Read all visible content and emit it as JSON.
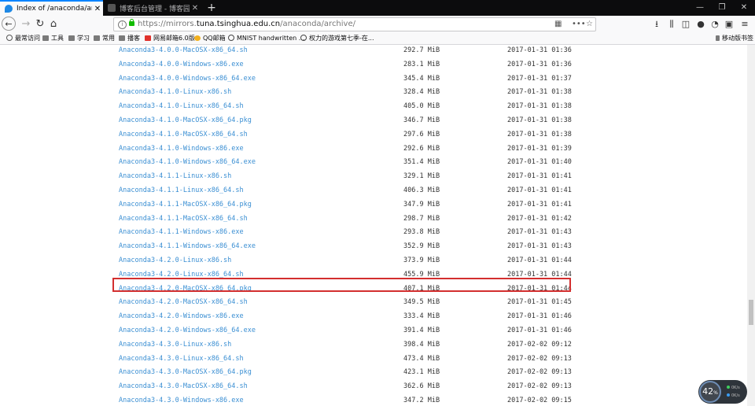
{
  "tabs": [
    {
      "title": "Index of /anaconda/archive/",
      "active": true
    },
    {
      "title": "博客后台管理 - 博客园",
      "active": false
    }
  ],
  "address": {
    "prefix": "https://mirrors.",
    "host": "tuna.tsinghua.edu.cn",
    "path": "/anaconda/archive/",
    "menu": "•••"
  },
  "bookmarks": [
    "最常访问",
    "工具",
    "学习",
    "常用",
    "播客",
    "网易邮箱6.0版",
    "QQ邮箱",
    "MNIST handwritten ...",
    "权力的游戏第七季-在..."
  ],
  "mobile_bookmarks": "移动版书签",
  "files": [
    {
      "name": "Anaconda3-4.0.0-MacOSX-x86_64.sh",
      "size": "292.7 MiB",
      "date": "2017-01-31 01:36"
    },
    {
      "name": "Anaconda3-4.0.0-Windows-x86.exe",
      "size": "283.1 MiB",
      "date": "2017-01-31 01:36"
    },
    {
      "name": "Anaconda3-4.0.0-Windows-x86_64.exe",
      "size": "345.4 MiB",
      "date": "2017-01-31 01:37"
    },
    {
      "name": "Anaconda3-4.1.0-Linux-x86.sh",
      "size": "328.4 MiB",
      "date": "2017-01-31 01:38"
    },
    {
      "name": "Anaconda3-4.1.0-Linux-x86_64.sh",
      "size": "405.0 MiB",
      "date": "2017-01-31 01:38"
    },
    {
      "name": "Anaconda3-4.1.0-MacOSX-x86_64.pkg",
      "size": "346.7 MiB",
      "date": "2017-01-31 01:38"
    },
    {
      "name": "Anaconda3-4.1.0-MacOSX-x86_64.sh",
      "size": "297.6 MiB",
      "date": "2017-01-31 01:38"
    },
    {
      "name": "Anaconda3-4.1.0-Windows-x86.exe",
      "size": "292.6 MiB",
      "date": "2017-01-31 01:39"
    },
    {
      "name": "Anaconda3-4.1.0-Windows-x86_64.exe",
      "size": "351.4 MiB",
      "date": "2017-01-31 01:40"
    },
    {
      "name": "Anaconda3-4.1.1-Linux-x86.sh",
      "size": "329.1 MiB",
      "date": "2017-01-31 01:41"
    },
    {
      "name": "Anaconda3-4.1.1-Linux-x86_64.sh",
      "size": "406.3 MiB",
      "date": "2017-01-31 01:41"
    },
    {
      "name": "Anaconda3-4.1.1-MacOSX-x86_64.pkg",
      "size": "347.9 MiB",
      "date": "2017-01-31 01:41"
    },
    {
      "name": "Anaconda3-4.1.1-MacOSX-x86_64.sh",
      "size": "298.7 MiB",
      "date": "2017-01-31 01:42"
    },
    {
      "name": "Anaconda3-4.1.1-Windows-x86.exe",
      "size": "293.8 MiB",
      "date": "2017-01-31 01:43"
    },
    {
      "name": "Anaconda3-4.1.1-Windows-x86_64.exe",
      "size": "352.9 MiB",
      "date": "2017-01-31 01:43"
    },
    {
      "name": "Anaconda3-4.2.0-Linux-x86.sh",
      "size": "373.9 MiB",
      "date": "2017-01-31 01:44"
    },
    {
      "name": "Anaconda3-4.2.0-Linux-x86_64.sh",
      "size": "455.9 MiB",
      "date": "2017-01-31 01:44"
    },
    {
      "name": "Anaconda3-4.2.0-MacOSX-x86_64.pkg",
      "size": "407.1 MiB",
      "date": "2017-01-31 01:44"
    },
    {
      "name": "Anaconda3-4.2.0-MacOSX-x86_64.sh",
      "size": "349.5 MiB",
      "date": "2017-01-31 01:45"
    },
    {
      "name": "Anaconda3-4.2.0-Windows-x86.exe",
      "size": "333.4 MiB",
      "date": "2017-01-31 01:46"
    },
    {
      "name": "Anaconda3-4.2.0-Windows-x86_64.exe",
      "size": "391.4 MiB",
      "date": "2017-01-31 01:46"
    },
    {
      "name": "Anaconda3-4.3.0-Linux-x86.sh",
      "size": "398.4 MiB",
      "date": "2017-02-02 09:12"
    },
    {
      "name": "Anaconda3-4.3.0-Linux-x86_64.sh",
      "size": "473.4 MiB",
      "date": "2017-02-02 09:13"
    },
    {
      "name": "Anaconda3-4.3.0-MacOSX-x86_64.pkg",
      "size": "423.1 MiB",
      "date": "2017-02-02 09:13"
    },
    {
      "name": "Anaconda3-4.3.0-MacOSX-x86_64.sh",
      "size": "362.6 MiB",
      "date": "2017-02-02 09:13"
    },
    {
      "name": "Anaconda3-4.3.0-Windows-x86.exe",
      "size": "347.2 MiB",
      "date": "2017-02-02 09:15"
    }
  ],
  "highlighted_file": "Anaconda3-4.2.0-Windows-x86_64.exe",
  "widget": {
    "value": "42",
    "unit": "%",
    "line1": "0K/s",
    "line2": "0K/s"
  },
  "colors": {
    "link": "#3b8fd3",
    "highlight": "#d32f2f",
    "tab_accent": "#0a84ff"
  }
}
